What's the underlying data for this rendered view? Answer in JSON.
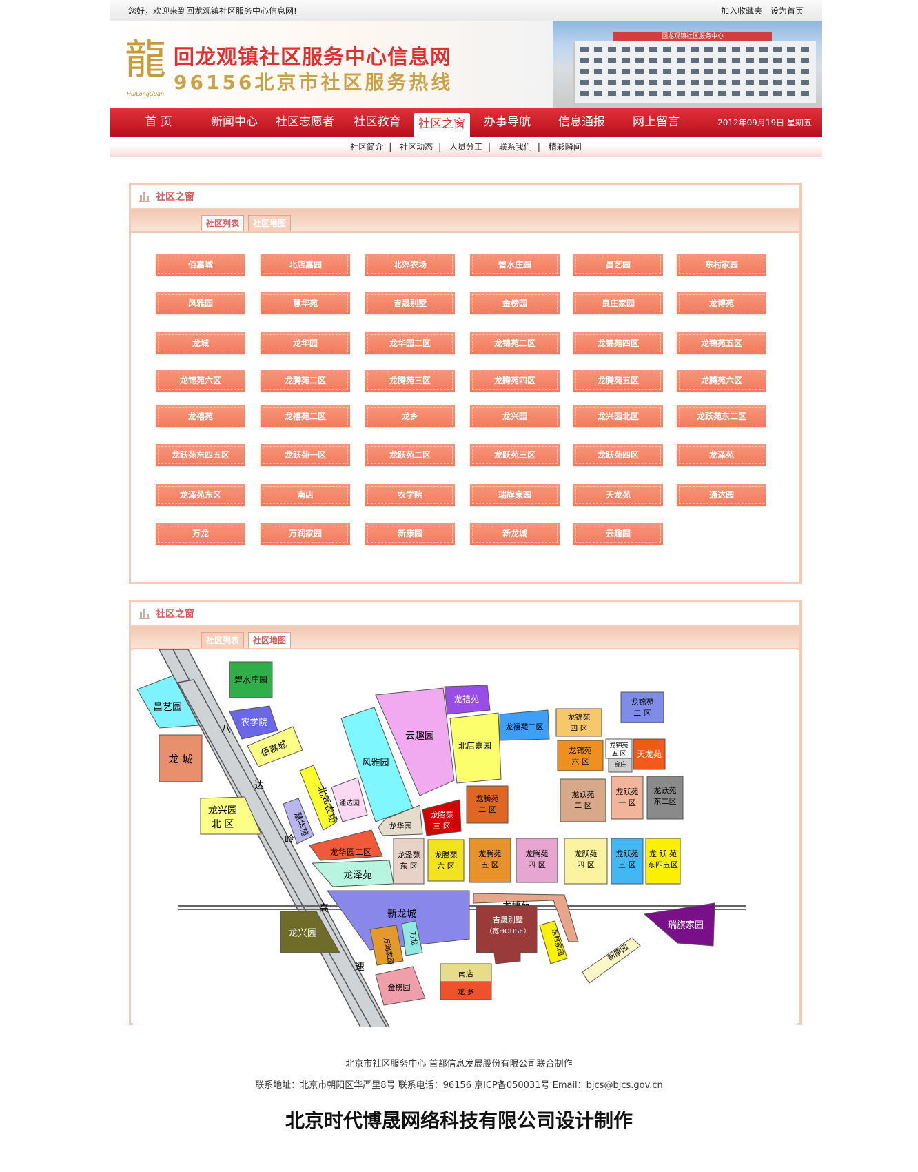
{
  "topbar": {
    "welcome": "您好，欢迎来到回龙观镇社区服务中心信息网!",
    "favorite": "加入收藏夹",
    "homepage": "设为首页"
  },
  "banner": {
    "title": "回龙观镇社区服务中心信息网",
    "subtitle": "96156北京市社区服务热线",
    "logo_glyph": "龍",
    "logo_pinyin": "HuiLongGuan",
    "building_sign": "回龙观镇社区服务中心"
  },
  "nav": {
    "items": [
      "首 页",
      "新闻中心",
      "社区志愿者",
      "社区教育",
      "社区之窗",
      "办事导航",
      "信息通报",
      "网上留言"
    ],
    "active_index": 4,
    "date": "2012年09月19日 星期五"
  },
  "subnav": [
    "社区简介",
    "社区动态",
    "人员分工",
    "联系我们",
    "精彩瞬间"
  ],
  "panel1": {
    "title": "社区之窗",
    "tabs": [
      "社区列表",
      "社区地图"
    ],
    "active_tab": 0,
    "communities": [
      "佰嘉城",
      "北店嘉园",
      "北郊农场",
      "碧水庄园",
      "昌艺园",
      "东村家园",
      "风雅园",
      "慧华苑",
      "吉晟别墅",
      "金榜园",
      "良庄家园",
      "龙博苑",
      "龙城",
      "龙华园",
      "龙华园二区",
      "龙锦苑二区",
      "龙锦苑四区",
      "龙锦苑五区",
      "龙锦苑六区",
      "龙腾苑二区",
      "龙腾苑三区",
      "龙腾苑四区",
      "龙腾苑五区",
      "龙腾苑六区",
      "龙禧苑",
      "龙禧苑二区",
      "龙乡",
      "龙兴园",
      "龙兴园北区",
      "龙跃苑东二区",
      "龙跃苑东四五区",
      "龙跃苑一区",
      "龙跃苑二区",
      "龙跃苑三区",
      "龙跃苑四区",
      "龙泽苑",
      "龙泽苑东区",
      "南店",
      "农学院",
      "瑞旗家园",
      "天龙苑",
      "通达园",
      "万龙",
      "万润家园",
      "新康园",
      "新龙城",
      "云趣园"
    ]
  },
  "panel2": {
    "title": "社区之窗",
    "tabs": [
      "社区列表",
      "社区地图"
    ],
    "active_tab": 1,
    "road_labels": [
      "八",
      "达",
      "岭",
      "高",
      "速"
    ],
    "map_labels": {
      "bishui": "碧水庄园",
      "changyi": "昌艺园",
      "nongxue": "农学院",
      "baijia": "佰嘉城",
      "longcheng": "龙 城",
      "longxing_bei_1": "龙兴园",
      "longxing_bei_2": "北  区",
      "beijiao": "北郊农场",
      "huihua": "慧华苑",
      "tongda": "通达园",
      "fengya": "风雅园",
      "yunqu": "云趣园",
      "longxi": "龙禧苑",
      "beidian": "北店嘉园",
      "longxi2": "龙禧苑二区",
      "longjin2_1": "龙锦苑",
      "longjin2_2": "四  区",
      "longjin6_1": "龙锦苑",
      "longjin6_2": "六  区",
      "longjin5_1": "龙锦苑",
      "longjin5_2": "五  区",
      "liangzhuang_1": "良庄",
      "liangzhuang_2": "家园",
      "tianlong": "天龙苑",
      "longjin_e2_1": "龙锦苑",
      "longjin_e2_2": "二  区",
      "longyue2_1": "龙跃苑",
      "longyue2_2": "二  区",
      "longyue1_1": "龙跃苑",
      "longyue1_2": "一  区",
      "longyue_e2_1": "龙跃苑",
      "longyue_e2_2": "东二区",
      "longhua": "龙华园",
      "longhua2": "龙华园二区",
      "longze": "龙泽苑",
      "longze_e_1": "龙泽苑",
      "longze_e_2": "东  区",
      "longteng3_1": "龙腾苑",
      "longteng3_2": "三  区",
      "longteng2_1": "龙腾苑",
      "longteng2_2": "二  区",
      "longteng6_1": "龙腾苑",
      "longteng6_2": "六  区",
      "longteng5_1": "龙腾苑",
      "longteng5_2": "五  区",
      "longteng4_1": "龙腾苑",
      "longteng4_2": "四  区",
      "longyue4_1": "龙跃苑",
      "longyue4_2": "四  区",
      "longyue3_1": "龙跃苑",
      "longyue3_2": "三  区",
      "longyue45_1": "龙 跃 苑",
      "longyue45_2": "东四五区",
      "xinlong": "新龙城",
      "longbo": "龙博苑",
      "jisheng_1": "吉晟别墅",
      "jisheng_2": "（宽HOUSE）",
      "longxing": "龙兴园",
      "wanrun": "万润家园",
      "wanlong": "万龙",
      "jinbang": "金榜园",
      "nandian": "南店",
      "longxiang": "龙 乡",
      "dongcun": "东村家园",
      "xinkang": "新康园",
      "ruiqi": "瑞旗家园"
    }
  },
  "footer": {
    "line1": "北京市社区服务中心  首都信息发展股份有限公司联合制作",
    "line2": "联系地址：北京市朝阳区华严里8号  联系电话：96156 京ICP备050031号  Email：bjcs@bjcs.gov.cn",
    "designer": "北京时代博晟网络科技有限公司设计制作"
  }
}
